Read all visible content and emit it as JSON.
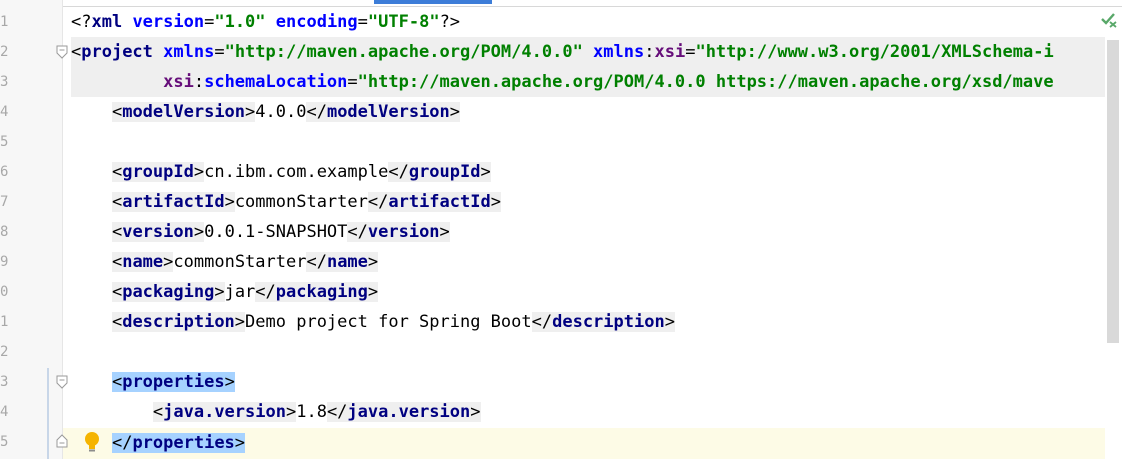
{
  "gutter": {
    "line_numbers": [
      "1",
      "2",
      "3",
      "4",
      "5",
      "6",
      "7",
      "8",
      "9",
      "0",
      "1",
      "2",
      "3",
      "4",
      "5"
    ]
  },
  "code": {
    "l1": {
      "open": "<?",
      "name": "xml",
      "a1": " version",
      "eq1": "=",
      "v1": "\"1.0\"",
      "a2": " encoding",
      "eq2": "=",
      "v2": "\"UTF-8\"",
      "close": "?>"
    },
    "l2": {
      "lt": "<",
      "tag": "project",
      "a1": " xmlns",
      "eq1": "=",
      "v1": "\"http://maven.apache.org/POM/4.0.0\"",
      "a2ns": " xmlns",
      "colon": ":",
      "a2": "xsi",
      "eq2": "=",
      "v2": "\"http://www.w3.org/2001/XMLSchema-i"
    },
    "l3": {
      "ns": "xsi",
      "colon": ":",
      "attr": "schemaLocation",
      "eq": "=",
      "val": "\"http://maven.apache.org/POM/4.0.0 https://maven.apache.org/xsd/mave"
    },
    "l4": {
      "open": "modelVersion",
      "text": "4.0.0",
      "close": "modelVersion"
    },
    "l6": {
      "open": "groupId",
      "text": "cn.ibm.com.example",
      "close": "groupId"
    },
    "l7": {
      "open": "artifactId",
      "text": "commonStarter",
      "close": "artifactId"
    },
    "l8": {
      "open": "version",
      "text": "0.0.1-SNAPSHOT",
      "close": "version"
    },
    "l9": {
      "open": "name",
      "text": "commonStarter",
      "close": "name"
    },
    "l10": {
      "open": "packaging",
      "text": "jar",
      "close": "packaging"
    },
    "l11": {
      "open": "description",
      "text": "Demo project for Spring Boot",
      "close": "description"
    },
    "l13": {
      "open": "properties"
    },
    "l14": {
      "open": "java.version",
      "text": "1.8",
      "close": "java.version"
    },
    "l15": {
      "close": "properties"
    }
  },
  "colors": {
    "tag": "#000080",
    "attribute": "#0000ff",
    "namespace": "#660e7a",
    "string": "#008000",
    "selection": "#a6d2ff",
    "current_line": "#fdfbe6",
    "tab_indicator": "#3d7dd8"
  },
  "icons": {
    "inspection": "check-icon",
    "intention": "lightbulb-icon"
  }
}
